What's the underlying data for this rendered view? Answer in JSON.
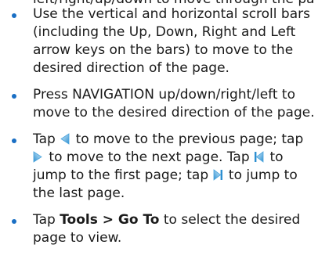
{
  "partial_top_line": "left/right/up/down to move through the page.",
  "items": [
    {
      "text": "Use the vertical and horizontal scroll bars (including the Up, Down, Right and Left arrow keys on the bars) to move to the desired direction of the page."
    },
    {
      "text": "Press NAVIGATION up/down/right/left to move to the desired direction of the page."
    },
    {
      "t1": "Tap ",
      "t2": " to move to the previous page; tap ",
      "t3": " to move to the next page. Tap ",
      "t4": " to jump to the first page; tap ",
      "t5": " to jump to the last page.",
      "icons": [
        "previous-page-icon",
        "next-page-icon",
        "first-page-icon",
        "last-page-icon"
      ]
    },
    {
      "t1": "Tap ",
      "bold": "Tools > Go To",
      "t2": " to select the desired page to view."
    }
  ],
  "colors": {
    "bullet": "#1a6fc4",
    "icon_light": "#bfe3f7",
    "icon_dark": "#2d8fd1",
    "text": "#1a1a1a"
  }
}
